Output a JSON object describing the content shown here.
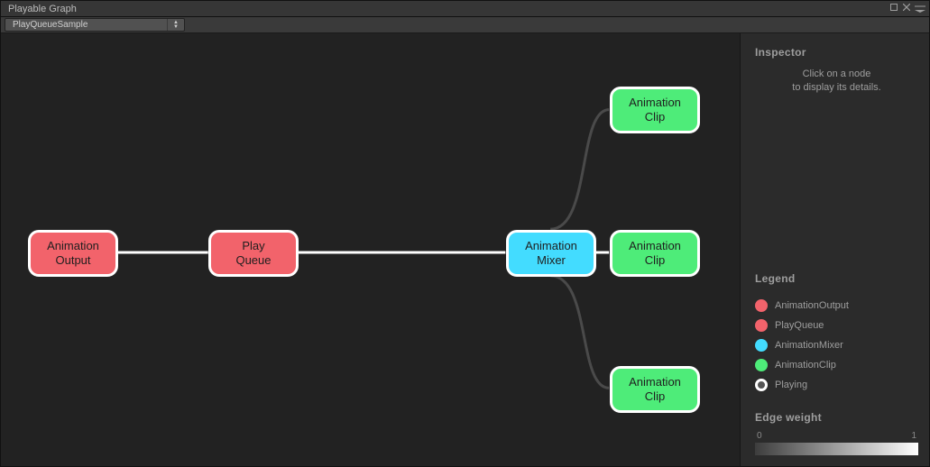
{
  "window": {
    "title": "Playable Graph"
  },
  "toolbar": {
    "dropdown_value": "PlayQueueSample"
  },
  "inspector": {
    "heading": "Inspector",
    "hint_line1": "Click on a node",
    "hint_line2": "to display its details."
  },
  "legend": {
    "heading": "Legend",
    "items": [
      {
        "label": "AnimationOutput",
        "swatch": "red"
      },
      {
        "label": "PlayQueue",
        "swatch": "red"
      },
      {
        "label": "AnimationMixer",
        "swatch": "cyan"
      },
      {
        "label": "AnimationClip",
        "swatch": "green"
      },
      {
        "label": "Playing",
        "swatch": "playing"
      }
    ]
  },
  "edge_weight": {
    "heading": "Edge weight",
    "min": "0",
    "max": "1"
  },
  "nodes": {
    "output": "Animation\nOutput",
    "queue": "Play\nQueue",
    "mixer": "Animation\nMixer",
    "clip1": "Animation\nClip",
    "clip2": "Animation\nClip",
    "clip3": "Animation\nClip"
  }
}
